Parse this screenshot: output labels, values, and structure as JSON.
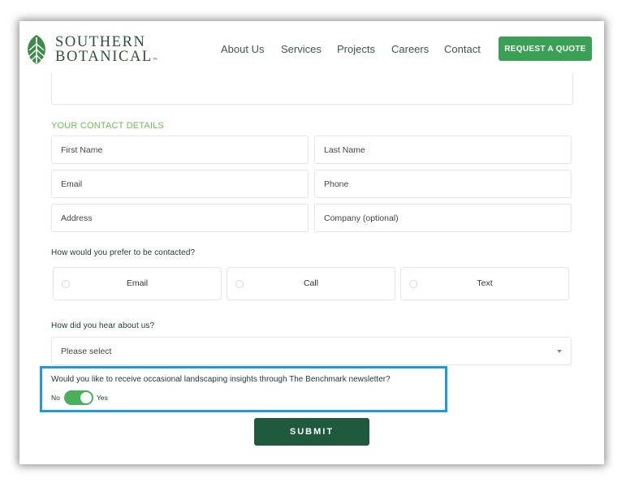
{
  "brand": {
    "line1": "SOUTHERN",
    "line2": "BOTANICAL",
    "tm": "™",
    "logo_icon": "leaf-icon",
    "color": "#2e4f3b"
  },
  "nav": {
    "items": [
      "About Us",
      "Services",
      "Projects",
      "Careers",
      "Contact"
    ],
    "cta_label": "REQUEST A QUOTE",
    "cta_color": "#3aa055"
  },
  "form": {
    "contact_section_title": "YOUR CONTACT DETAILS",
    "placeholders": {
      "first_name": "First Name",
      "last_name": "Last Name",
      "email": "Email",
      "phone": "Phone",
      "address": "Address",
      "company": "Company (optional)"
    },
    "contact_method": {
      "question": "How would you prefer to be contacted?",
      "options": [
        "Email",
        "Call",
        "Text"
      ]
    },
    "referral": {
      "question": "How did you hear about us?",
      "selected": "Please select"
    },
    "newsletter": {
      "question": "Would you like to receive occasional landscaping insights through The Benchmark newsletter?",
      "no_label": "No",
      "yes_label": "Yes",
      "value": "Yes",
      "toggle_color": "#48b05a"
    },
    "submit_label": "SUBMIT",
    "submit_color": "#1f5a3e"
  },
  "highlight_color": "#1e9ad6"
}
